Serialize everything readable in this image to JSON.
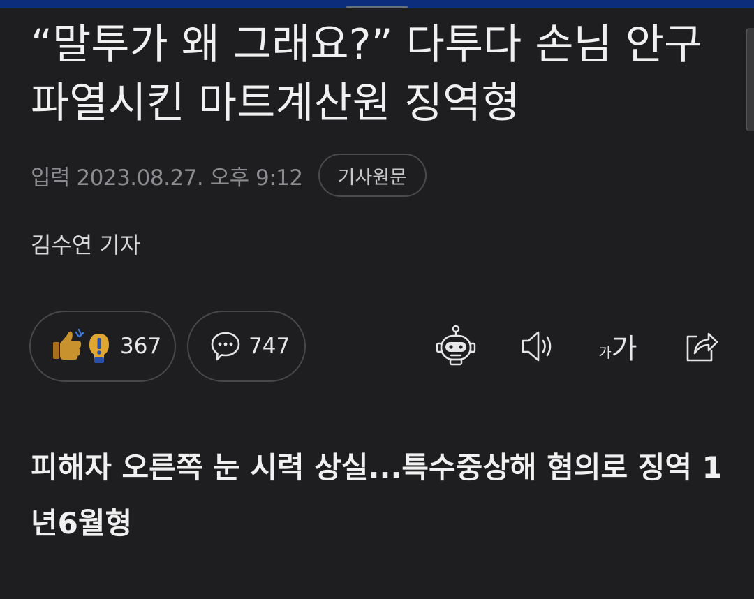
{
  "article": {
    "headline": "“말투가 왜 그래요?” 다투다 손님 안구 파열시킨 마트계산원 징역형",
    "timestamp": "입력 2023.08.27. 오후 9:12",
    "original_link_label": "기사원문",
    "reporter": "김수연 기자",
    "subheadline": "피해자 오른쪽 눈 시력 상실...특수중상해 혐의로 징역 1년6월형"
  },
  "engagement": {
    "reactions_count": "367",
    "comments_count": "747",
    "reaction_icons": [
      "thumbs-up-icon",
      "exclamation-icon"
    ],
    "comment_icon": "speech-bubble-icon"
  },
  "toolbar": {
    "ai_icon": "robot-icon",
    "audio_icon": "speaker-icon",
    "font_small_glyph": "가",
    "font_big_glyph": "가",
    "share_icon": "share-icon"
  },
  "colors": {
    "background": "#1e1e20",
    "top_bar": "#0c2c7c",
    "reaction_gold": "#c8932e",
    "reaction_blue": "#2a4fa8"
  }
}
